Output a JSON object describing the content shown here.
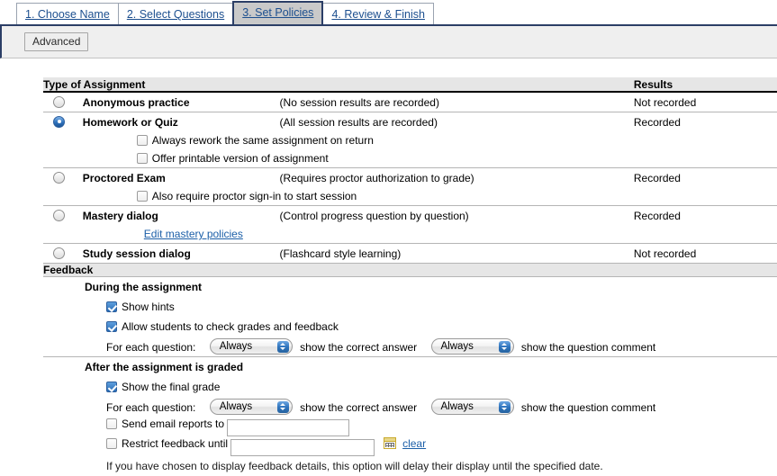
{
  "tabs": [
    {
      "label": "1. Choose Name",
      "active": false
    },
    {
      "label": "2. Select Questions",
      "active": false
    },
    {
      "label": "3. Set Policies",
      "active": true
    },
    {
      "label": "4. Review & Finish",
      "active": false
    }
  ],
  "toolbar": {
    "advanced_label": "Advanced"
  },
  "table": {
    "header_type": "Type of Assignment",
    "header_results": "Results",
    "rows": [
      {
        "name": "Anonymous practice",
        "desc": "(No session results are recorded)",
        "results": "Not recorded",
        "selected": false,
        "subitems": []
      },
      {
        "name": "Homework or Quiz",
        "desc": "(All session results are recorded)",
        "results": "Recorded",
        "selected": true,
        "subitems": [
          {
            "label": "Always rework the same assignment on return",
            "checked": false
          },
          {
            "label": "Offer printable version of assignment",
            "checked": false
          }
        ]
      },
      {
        "name": "Proctored Exam",
        "desc": "(Requires proctor authorization to grade)",
        "results": "Recorded",
        "selected": false,
        "subitems": [
          {
            "label": "Also require proctor sign-in to start session",
            "checked": false
          }
        ]
      },
      {
        "name": "Mastery dialog",
        "desc": "(Control progress question by question)",
        "results": "Recorded",
        "selected": false,
        "link": "Edit mastery policies",
        "subitems": []
      },
      {
        "name": "Study session dialog",
        "desc": "(Flashcard style learning)",
        "results": "Not recorded",
        "selected": false,
        "subitems": []
      }
    ]
  },
  "feedback": {
    "section_title": "Feedback",
    "during": {
      "title": "During the assignment",
      "show_hints": {
        "label": "Show hints",
        "checked": true
      },
      "allow_check": {
        "label": "Allow students to check grades and feedback",
        "checked": true
      },
      "for_each_label": "For each question:",
      "correct_answer_value": "Always",
      "correct_answer_text": "show the correct answer",
      "question_comment_value": "Always",
      "question_comment_text": "show the question comment"
    },
    "after": {
      "title": "After the assignment is graded",
      "show_final_grade": {
        "label": "Show the final grade",
        "checked": true
      },
      "for_each_label": "For each question:",
      "correct_answer_value": "Always",
      "correct_answer_text": "show the correct answer",
      "question_comment_value": "Always",
      "question_comment_text": "show the question comment",
      "email_reports": {
        "label": "Send email reports to",
        "checked": false,
        "value": "",
        "placeholder": ""
      },
      "restrict": {
        "label": "Restrict feedback until",
        "checked": false,
        "value": "",
        "placeholder": "",
        "clear_label": "clear",
        "calendar_icon": "calendar-icon"
      },
      "note": "If you have chosen to display feedback details, this option will delay their display until the specified date."
    }
  },
  "colors": {
    "link": "#1c5fa8",
    "active_tab_bg": "#c9c9c9",
    "active_tab_border": "#2b3e66",
    "section_header_bg": "#e6e6e6",
    "toolbar_bg": "#efefef"
  }
}
